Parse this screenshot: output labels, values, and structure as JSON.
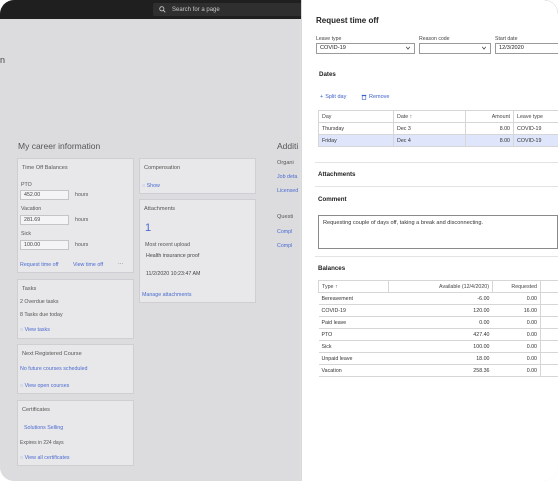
{
  "topbar": {
    "search_placeholder": "Search for a page"
  },
  "background": {
    "heading_fragment": "n",
    "section_title": "My career information",
    "additional_fragment": "Additi",
    "organization_fragment": "Organi",
    "org_links": [
      "Job deta",
      "Licensed"
    ],
    "questions_fragment": "Questi",
    "question_links": [
      "Compl",
      "Compl"
    ],
    "time_off": {
      "title": "Time Off Balances",
      "rows": [
        {
          "label": "PTO",
          "value": "452.00",
          "unit": "hours"
        },
        {
          "label": "Vacation",
          "value": "281.69",
          "unit": "hours"
        },
        {
          "label": "Sick",
          "value": "100.00",
          "unit": "hours"
        }
      ],
      "request_link": "Request time off",
      "view_link": "View time off",
      "more": "···"
    },
    "compensation": {
      "title": "Compensation",
      "show_link": "Show"
    },
    "attachments": {
      "title": "Attachments",
      "count": "1",
      "recent_label": "Most recent upload",
      "recent_name": "Health insurance proof",
      "recent_time": "11/2/2020 10:23:47 AM",
      "manage_link": "Manage attachments"
    },
    "tasks": {
      "title": "Tasks",
      "overdue": "2 Overdue tasks",
      "due_today": "8 Tasks due today",
      "view_link": "View tasks"
    },
    "next_course": {
      "title": "Next Registered Course",
      "none_link": "No future courses scheduled",
      "view_link": "View open courses"
    },
    "certificates": {
      "title": "Certificates",
      "item_link": "Solutions Selling",
      "expires": "Expires in 224 days",
      "view_link": "View all certificates"
    }
  },
  "panel": {
    "title": "Request time off",
    "leave_type_label": "Leave type",
    "leave_type_value": "COVID-19",
    "reason_code_label": "Reason code",
    "reason_code_value": "",
    "start_date_label": "Start date",
    "start_date_value": "12/3/2020",
    "dates_section": "Dates",
    "split_day": "Split day",
    "remove": "Remove",
    "dates_table": {
      "headers": [
        "Day",
        "Date ↑",
        "Amount",
        "Leave type"
      ],
      "rows": [
        [
          "Thursday",
          "Dec 3",
          "8.00",
          "COVID-19"
        ],
        [
          "Friday",
          "Dec 4",
          "8.00",
          "COVID-19"
        ]
      ]
    },
    "attachments_section": "Attachments",
    "comment_section": "Comment",
    "comment_text": "Requesting couple of days off, taking a break and disconnecting.",
    "balances_section": "Balances",
    "balances_table": {
      "headers": [
        "Type ↑",
        "Available (12/4/2020)",
        "Requested"
      ],
      "rows": [
        [
          "Bereavement",
          "-6.00",
          "0.00"
        ],
        [
          "COVID-19",
          "120.00",
          "16.00"
        ],
        [
          "Paid leave",
          "0.00",
          "0.00"
        ],
        [
          "PTO",
          "427.40",
          "0.00"
        ],
        [
          "Sick",
          "100.00",
          "0.00"
        ],
        [
          "Unpaid leave",
          "18.00",
          "0.00"
        ],
        [
          "Vacation",
          "258.36",
          "0.00"
        ]
      ]
    }
  },
  "colors": {
    "topbar": "#1f1f1f",
    "link": "#4a6ad0",
    "selected_row": "#dfe6fb"
  }
}
